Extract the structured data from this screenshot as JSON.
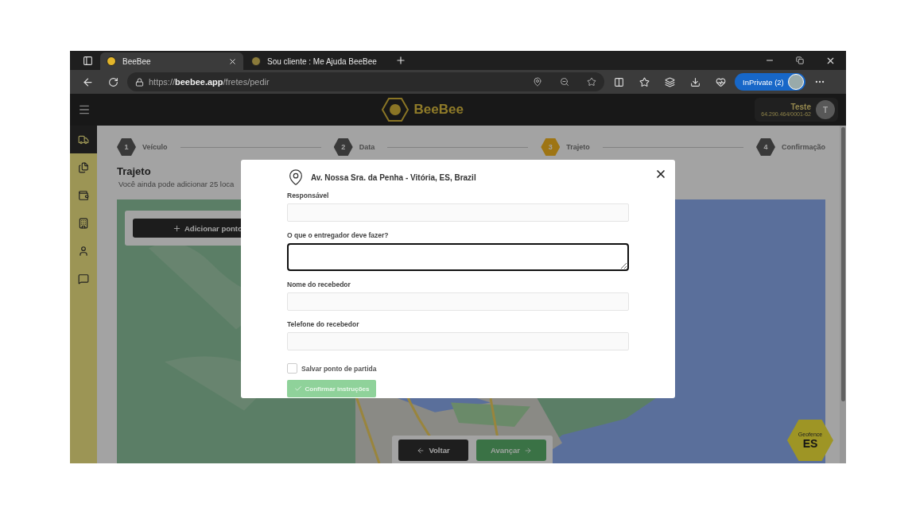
{
  "browser": {
    "tabs": [
      {
        "title": "BeeBee",
        "selected": true
      },
      {
        "title": "Sou cliente : Me Ajuda BeeBee",
        "selected": false
      }
    ],
    "url": {
      "scheme": "https://",
      "host": "beebee.app",
      "path": "/fretes/pedir"
    },
    "profile": "InPrivate (2)"
  },
  "header": {
    "brand": "BeeBee",
    "user_name": "Teste",
    "user_id": "64.290.464/0001-62",
    "avatar": "T"
  },
  "sidebar": {
    "items": [
      {
        "kind": "truck",
        "selected": true
      },
      {
        "kind": "files",
        "selected": false
      },
      {
        "kind": "wallet",
        "selected": false
      },
      {
        "kind": "building",
        "selected": false
      },
      {
        "kind": "user",
        "selected": false
      },
      {
        "kind": "chat",
        "selected": false
      }
    ]
  },
  "steps": [
    {
      "number": "1",
      "label": "Veículo",
      "selected": false
    },
    {
      "number": "2",
      "label": "Data",
      "selected": false
    },
    {
      "number": "3",
      "label": "Trajeto",
      "selected": true
    },
    {
      "number": "4",
      "label": "Confirmação",
      "selected": false
    }
  ],
  "section": {
    "title": "Trajeto",
    "subtitle": "Você ainda pode adicionar 25 loca"
  },
  "map": {
    "kind": "picture",
    "add_button": "Adicionar ponto"
  },
  "nav": {
    "back": "Voltar",
    "next": "Avançar",
    "next_disabled": true
  },
  "geofence": {
    "label": "Geofence",
    "state": "ES"
  },
  "modal": {
    "address": "Av. Nossa Sra. da Penha - Vitória, ES, Brazil",
    "fields": [
      {
        "label": "Responsável",
        "kind": "input",
        "focused": false
      },
      {
        "label": "O que o entregador deve fazer?",
        "kind": "textarea",
        "focused": true
      },
      {
        "label": "Nome do recebedor",
        "kind": "input",
        "focused": false
      },
      {
        "label": "Telefone do recebedor",
        "kind": "input",
        "focused": false
      }
    ],
    "checkbox": {
      "label": "Salvar ponto de partida",
      "checked": false
    },
    "confirm": {
      "label": "Confirmar instruções",
      "disabled": true
    }
  }
}
